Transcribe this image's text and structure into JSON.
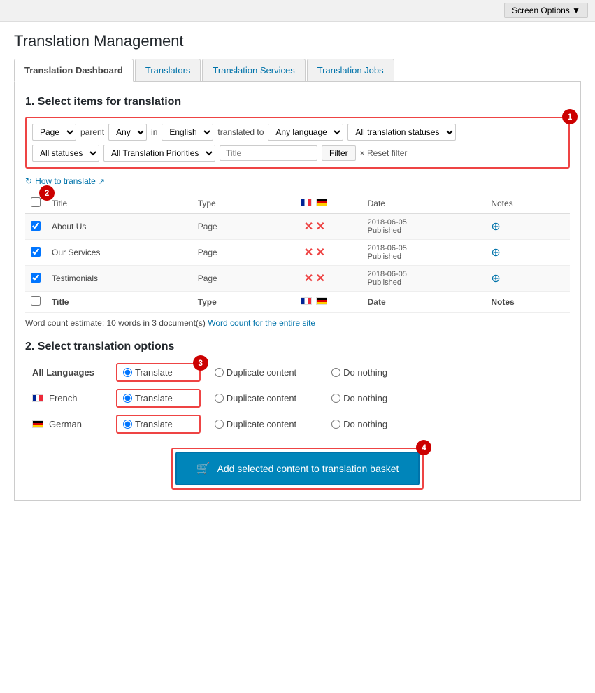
{
  "screen_options": {
    "label": "Screen Options ▼"
  },
  "page": {
    "title": "Translation Management"
  },
  "tabs": [
    {
      "id": "dashboard",
      "label": "Translation Dashboard",
      "active": true
    },
    {
      "id": "translators",
      "label": "Translators",
      "active": false
    },
    {
      "id": "services",
      "label": "Translation Services",
      "active": false
    },
    {
      "id": "jobs",
      "label": "Translation Jobs",
      "active": false
    }
  ],
  "section1": {
    "title": "1. Select items for translation",
    "badge": "1"
  },
  "filters": {
    "content_type": "Page",
    "parent_label": "parent",
    "parent_value": "Any",
    "in_label": "in",
    "language_value": "English",
    "translated_to_label": "translated to",
    "any_language": "Any language",
    "all_statuses_label": "All translation statuses",
    "statuses_row": {
      "all_statuses": "All statuses",
      "all_priorities": "All Translation Priorities",
      "title_placeholder": "Title",
      "filter_btn": "Filter",
      "reset_label": "× Reset filter"
    }
  },
  "help_link": {
    "label": "How to translate",
    "icon": "↻"
  },
  "table": {
    "badge": "2",
    "headers": {
      "title": "Title",
      "type": "Type",
      "date": "Date",
      "notes": "Notes"
    },
    "rows": [
      {
        "title": "About Us",
        "type": "Page",
        "date": "2018-06-05",
        "status": "Published"
      },
      {
        "title": "Our Services",
        "type": "Page",
        "date": "2018-06-05",
        "status": "Published"
      },
      {
        "title": "Testimonials",
        "type": "Page",
        "date": "2018-06-05",
        "status": "Published"
      }
    ],
    "footer": {
      "title": "Title",
      "type": "Type",
      "date": "Date",
      "notes": "Notes"
    }
  },
  "word_count": {
    "text": "Word count estimate: 10 words in 3 document(s)",
    "link_text": "Word count for the entire site"
  },
  "section2": {
    "title": "2. Select translation options",
    "badge": "3"
  },
  "translation_options": {
    "all_languages": {
      "label": "All Languages",
      "options": [
        "Translate",
        "Duplicate content",
        "Do nothing"
      ]
    },
    "languages": [
      {
        "name": "French",
        "flag": "fr",
        "options": [
          "Translate",
          "Duplicate content",
          "Do nothing"
        ]
      },
      {
        "name": "German",
        "flag": "de",
        "options": [
          "Translate",
          "Duplicate content",
          "Do nothing"
        ]
      }
    ]
  },
  "basket_button": {
    "label": "Add selected content to translation basket",
    "badge": "4"
  }
}
